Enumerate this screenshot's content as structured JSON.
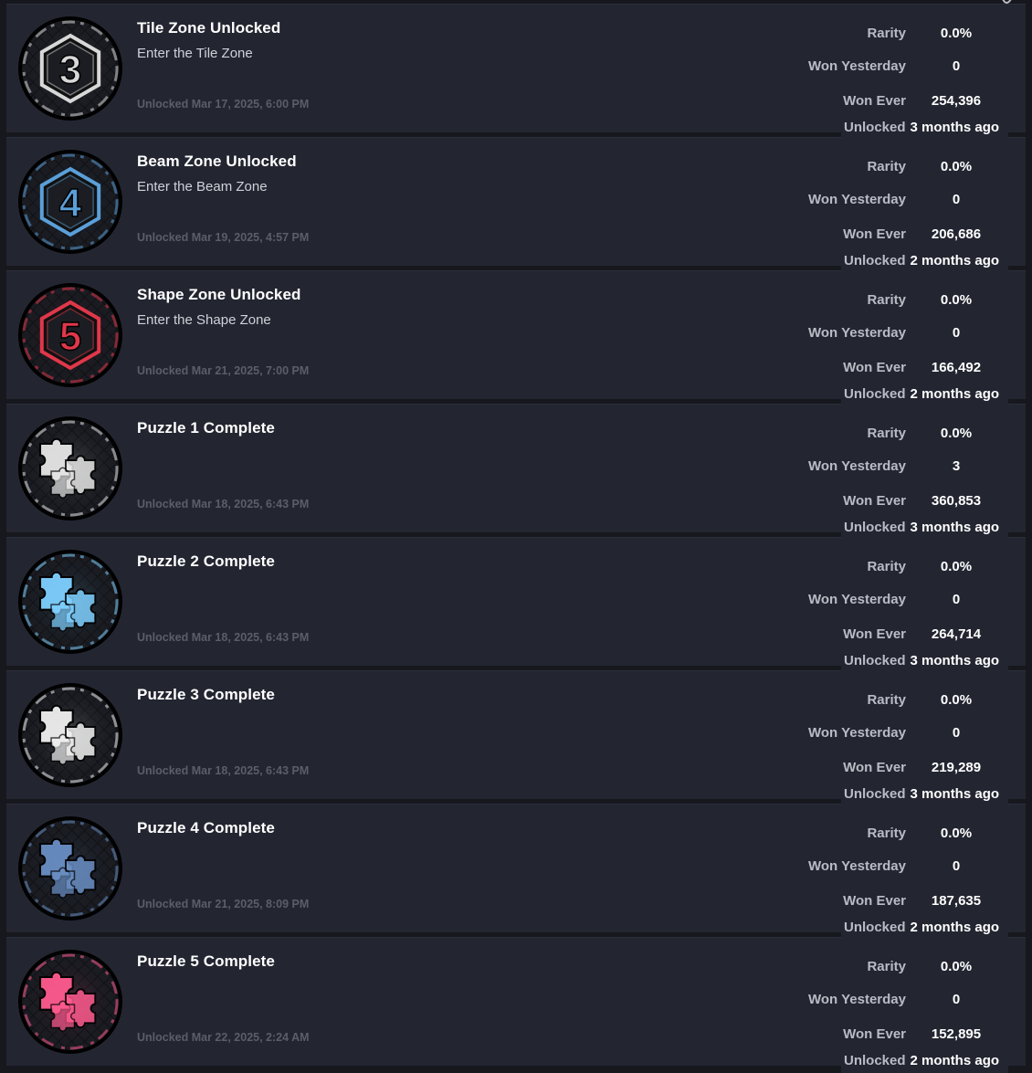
{
  "labels": {
    "rarity": "Rarity",
    "won_yesterday": "Won Yesterday",
    "won_ever": "Won Ever",
    "unlocked": "Unlocked"
  },
  "achievements": [
    {
      "title": "Tile Zone Unlocked",
      "description": "Enter the Tile Zone",
      "unlocked_date": "Unlocked Mar 17, 2025, 6:00 PM",
      "rarity": "0.0%",
      "won_yesterday": "0",
      "won_ever": "254,396",
      "unlocked_ago": "3 months ago",
      "badge_icon": "zone-3-hexagon-icon",
      "badge_glyph": "3",
      "badge_color": "#d8d8d8"
    },
    {
      "title": "Beam Zone Unlocked",
      "description": "Enter the Beam Zone",
      "unlocked_date": "Unlocked Mar 19, 2025, 4:57 PM",
      "rarity": "0.0%",
      "won_yesterday": "0",
      "won_ever": "206,686",
      "unlocked_ago": "2 months ago",
      "badge_icon": "zone-4-hexagon-icon",
      "badge_glyph": "4",
      "badge_color": "#5b9fd8"
    },
    {
      "title": "Shape Zone Unlocked",
      "description": "Enter the Shape Zone",
      "unlocked_date": "Unlocked Mar 21, 2025, 7:00 PM",
      "rarity": "0.0%",
      "won_yesterday": "0",
      "won_ever": "166,492",
      "unlocked_ago": "2 months ago",
      "badge_icon": "zone-5-hexagon-icon",
      "badge_glyph": "5",
      "badge_color": "#e0374a"
    },
    {
      "title": "Puzzle 1 Complete",
      "description": "",
      "unlocked_date": "Unlocked Mar 18, 2025, 6:43 PM",
      "rarity": "0.0%",
      "won_yesterday": "3",
      "won_ever": "360,853",
      "unlocked_ago": "3 months ago",
      "badge_icon": "puzzle-piece-icon",
      "badge_glyph": "",
      "badge_color": "#e6e6e6"
    },
    {
      "title": "Puzzle 2 Complete",
      "description": "",
      "unlocked_date": "Unlocked Mar 18, 2025, 6:43 PM",
      "rarity": "0.0%",
      "won_yesterday": "0",
      "won_ever": "264,714",
      "unlocked_ago": "3 months ago",
      "badge_icon": "puzzle-piece-icon",
      "badge_glyph": "",
      "badge_color": "#7fd0ff"
    },
    {
      "title": "Puzzle 3 Complete",
      "description": "",
      "unlocked_date": "Unlocked Mar 18, 2025, 6:43 PM",
      "rarity": "0.0%",
      "won_yesterday": "0",
      "won_ever": "219,289",
      "unlocked_ago": "3 months ago",
      "badge_icon": "puzzle-piece-icon",
      "badge_glyph": "",
      "badge_color": "#f0f0f0"
    },
    {
      "title": "Puzzle 4 Complete",
      "description": "",
      "unlocked_date": "Unlocked Mar 21, 2025, 8:09 PM",
      "rarity": "0.0%",
      "won_yesterday": "0",
      "won_ever": "187,635",
      "unlocked_ago": "2 months ago",
      "badge_icon": "puzzle-piece-icon",
      "badge_glyph": "",
      "badge_color": "#6a8fc4"
    },
    {
      "title": "Puzzle 5 Complete",
      "description": "",
      "unlocked_date": "Unlocked Mar 22, 2025, 2:24 AM",
      "rarity": "0.0%",
      "won_yesterday": "0",
      "won_ever": "152,895",
      "unlocked_ago": "2 months ago",
      "badge_icon": "puzzle-piece-icon",
      "badge_glyph": "",
      "badge_color": "#ff5b8f"
    }
  ]
}
